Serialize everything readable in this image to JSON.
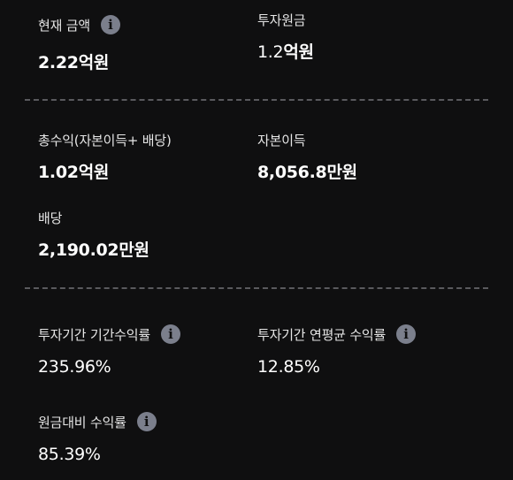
{
  "current_amount": {
    "label": "현재 금액",
    "value": "2.22",
    "unit": "억원",
    "icon": "info-icon"
  },
  "principal": {
    "label": "투자원금",
    "value": "1.2",
    "unit": "억원"
  },
  "total_return": {
    "label": "총수익(자본이득+ 배당)",
    "value": "1.02",
    "unit": "억원"
  },
  "capital_gain": {
    "label": "자본이득",
    "value": "8,056.8",
    "unit": "만원"
  },
  "dividend": {
    "label": "배당",
    "value": "2,190.02",
    "unit": "만원"
  },
  "period_return": {
    "label": "투자기간 기간수익률",
    "value": "235.96%",
    "icon": "info-icon"
  },
  "annual_return": {
    "label": "투자기간 연평균 수익률",
    "value": "12.85%",
    "icon": "info-icon"
  },
  "principal_return": {
    "label": "원금대비 수익률",
    "value": "85.39%",
    "icon": "info-icon"
  },
  "info_glyph": "i",
  "colors": {
    "background": "#0f0f10",
    "text": "#ffffff",
    "info_icon": "#7b7f8c",
    "divider": "#5a5a5e"
  }
}
